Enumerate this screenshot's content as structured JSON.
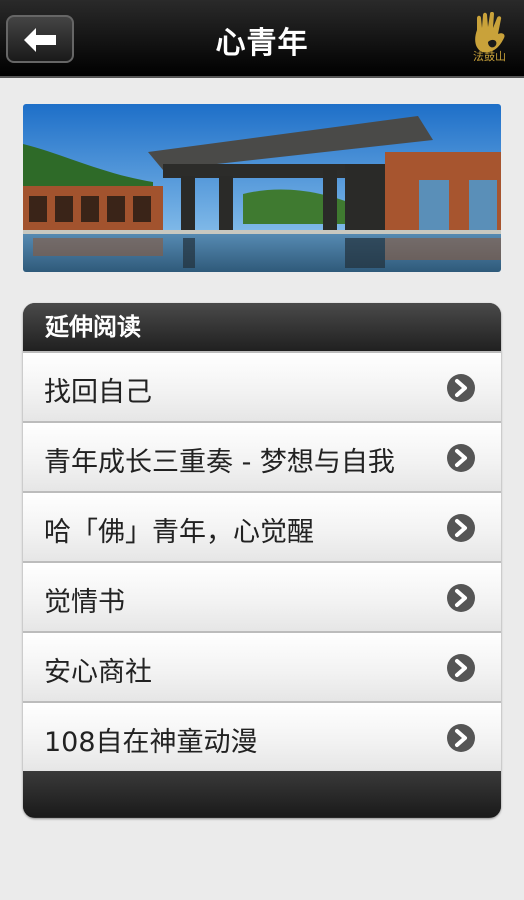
{
  "header": {
    "title": "心青年",
    "logo_text": "法鼓山",
    "back_icon": "back-arrow-icon"
  },
  "banner": {
    "image": "temple-building-photo"
  },
  "section": {
    "title": "延伸阅读",
    "items": [
      {
        "label": "找回自己"
      },
      {
        "label": "青年成长三重奏 - 梦想与自我"
      },
      {
        "label": "哈「佛」青年，心觉醒"
      },
      {
        "label": "觉情书"
      },
      {
        "label": "安心商社"
      },
      {
        "label": "108自在神童动漫"
      }
    ],
    "item_icon": "chevron-right-icon"
  }
}
